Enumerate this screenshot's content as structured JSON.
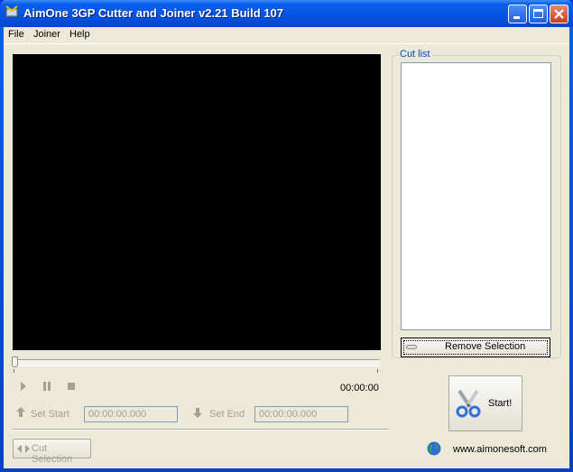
{
  "window": {
    "title": "AimOne 3GP Cutter and Joiner v2.21 Build 107",
    "controls": [
      "minimize",
      "maximize",
      "close"
    ]
  },
  "menu": {
    "items": [
      {
        "label": "File"
      },
      {
        "label": "Joiner"
      },
      {
        "label": "Help"
      }
    ]
  },
  "player": {
    "current_time": "00:00:00",
    "seek_position": 0,
    "controls": {
      "play": "play-icon",
      "pause": "pause-icon",
      "stop": "stop-icon"
    }
  },
  "selection": {
    "set_start_label": "Set Start",
    "start_value": "00:00:00.000",
    "set_end_label": "Set End",
    "end_value": "00:00:00.000",
    "cut_selection_label": "Cut Selection"
  },
  "cut_list": {
    "label": "Cut list",
    "items": [],
    "remove_label": "Remove Selection"
  },
  "start": {
    "label": "Start!"
  },
  "footer": {
    "website": "www.aimonesoft.com"
  },
  "colors": {
    "titlebar": "#0553e1",
    "window_bg": "#ece9d8",
    "group_label": "#0046d5",
    "disabled_text": "#a3a094"
  }
}
